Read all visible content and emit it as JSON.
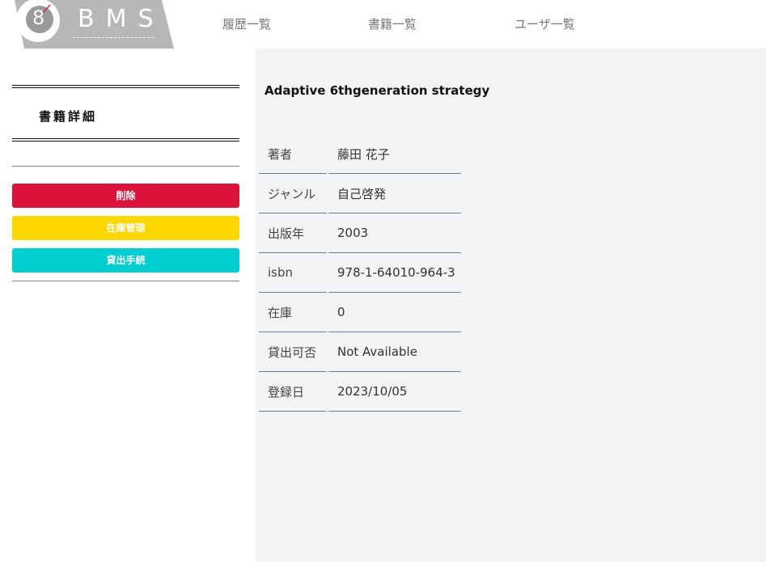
{
  "header": {
    "logo_digit": "8",
    "logo_text": "BMS",
    "nav": [
      {
        "label": "履歴一覧"
      },
      {
        "label": "書籍一覧"
      },
      {
        "label": "ユーザ一覧"
      }
    ]
  },
  "sidebar": {
    "title": "書籍詳細",
    "buttons": {
      "delete": "削除",
      "stock": "在庫管理",
      "loan": "貸出手続"
    }
  },
  "book": {
    "title": "Adaptive 6thgeneration strategy",
    "rows": [
      {
        "label": "著者",
        "value": "藤田 花子"
      },
      {
        "label": "ジャンル",
        "value": "自己啓発"
      },
      {
        "label": "出版年",
        "value": "2003"
      },
      {
        "label": "isbn",
        "value": "978-1-64010-964-3"
      },
      {
        "label": "在庫",
        "value": "0"
      },
      {
        "label": "貸出可否",
        "value": "Not Available"
      },
      {
        "label": "登録日",
        "value": "2023/10/05"
      }
    ]
  },
  "colors": {
    "logo_bg": "#b7b7b7",
    "delete": "#dc143c",
    "stock": "#ffd700",
    "loan": "#00ced1",
    "main_bg": "#f2f3f5"
  }
}
